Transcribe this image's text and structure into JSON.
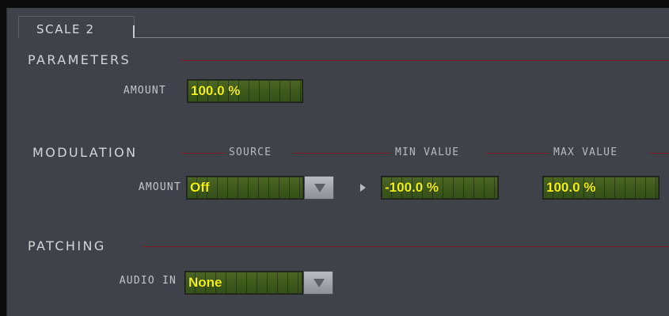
{
  "tab": {
    "label": "SCALE 2"
  },
  "parameters": {
    "title": "PARAMETERS",
    "amount_label": "AMOUNT",
    "amount_value": "100.0 %"
  },
  "modulation": {
    "title": "MODULATION",
    "source_header": "SOURCE",
    "min_header": "MIN VALUE",
    "max_header": "MAX VALUE",
    "amount_label": "AMOUNT",
    "source_value": "Off",
    "min_value": "-100.0 %",
    "max_value": "100.0 %"
  },
  "patching": {
    "title": "PATCHING",
    "audio_in_label": "AUDIO IN",
    "audio_in_value": "None"
  },
  "colors": {
    "lcd_text": "#f4f20f",
    "lcd_bg": "#3e5a1b",
    "divider": "#7a1d22",
    "panel_bg": "#3f4248"
  }
}
